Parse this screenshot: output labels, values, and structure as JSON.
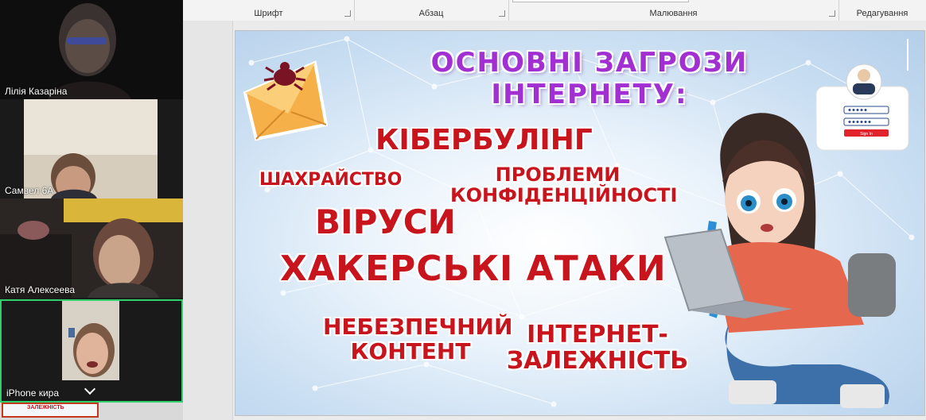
{
  "ribbon": {
    "groups": [
      {
        "label": "Шрифт"
      },
      {
        "label": "Абзац"
      },
      {
        "label": "Малювання"
      },
      {
        "label": "Редагування"
      }
    ]
  },
  "participants": [
    {
      "name": "Лілія Казаріна"
    },
    {
      "name": "Самвел 6А"
    },
    {
      "name": "Катя Алексеева"
    },
    {
      "name": "iPhone кира"
    }
  ],
  "slide": {
    "title": "ОСНОВНІ ЗАГРОЗИ ІНТЕРНЕТУ:",
    "threats": {
      "cyberbullying": "КІБЕРБУЛІНГ",
      "fraud": "ШАХРАЙСТВО",
      "privacy_line1": "ПРОБЛЕМИ",
      "privacy_line2": "КОНФІДЕНЦІЙНОСТІ",
      "viruses": "ВІРУСИ",
      "hacker": "ХАКЕРСЬКІ АТАКИ",
      "danger_line1": "НЕБЕЗПЕЧНИЙ",
      "danger_line2": "КОНТЕНТ",
      "addiction_line1": "ІНТЕРНЕТ-",
      "addiction_line2": "ЗАЛЕЖНІСТЬ"
    },
    "login_card": {
      "button_label": "Sign In"
    }
  },
  "thumbnail_text": "ЗАЛЕЖНІСТЬ",
  "colors": {
    "title": "#a12fd1",
    "threat": "#c8141c",
    "active_speaker_border": "#2fd06b"
  }
}
